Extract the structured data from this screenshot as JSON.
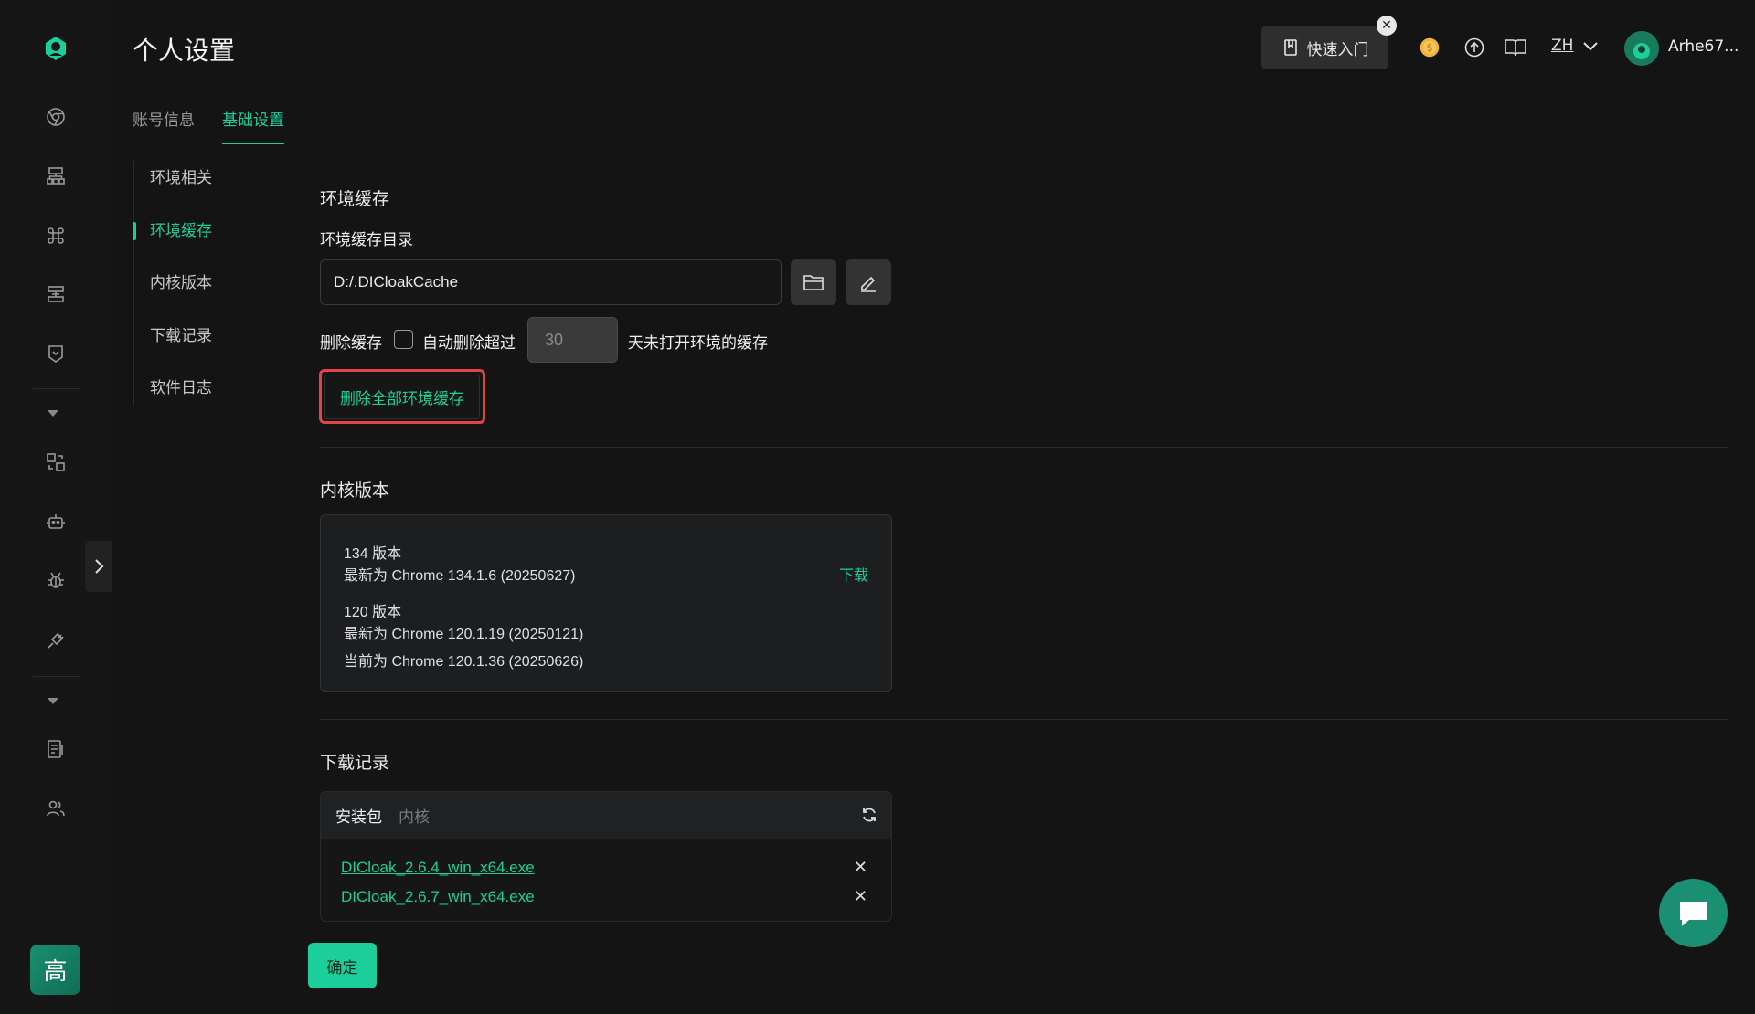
{
  "page": {
    "title": "个人设置",
    "tabs": [
      {
        "label": "账号信息",
        "active": false
      },
      {
        "label": "基础设置",
        "active": true
      }
    ]
  },
  "header": {
    "quick_start_label": "快速入门",
    "lang": "ZH",
    "username": "Arhe67..."
  },
  "side_menu": [
    {
      "label": "环境相关",
      "active": false
    },
    {
      "label": "环境缓存",
      "active": true
    },
    {
      "label": "内核版本",
      "active": false
    },
    {
      "label": "下载记录",
      "active": false
    },
    {
      "label": "软件日志",
      "active": false
    }
  ],
  "cache": {
    "section_title": "环境缓存",
    "dir_label": "环境缓存目录",
    "dir_value": "D:/.DICloakCache",
    "delete_label": "删除缓存",
    "auto_delete_label": "自动删除超过",
    "days_value": "30",
    "days_suffix": "天未打开环境的缓存",
    "delete_all_label": "删除全部环境缓存"
  },
  "kernel": {
    "section_title": "内核版本",
    "v134_title": "134 版本",
    "v134_latest": "最新为 Chrome 134.1.6 (20250627)",
    "download_label": "下载",
    "v120_title": "120 版本",
    "v120_latest": "最新为 Chrome 120.1.19 (20250121)",
    "v120_current": "当前为 Chrome 120.1.36 (20250626)"
  },
  "downloads": {
    "section_title": "下载记录",
    "tab_package": "安装包",
    "tab_kernel": "内核",
    "files": [
      "DICloak_2.6.4_win_x64.exe",
      "DICloak_2.6.7_win_x64.exe"
    ]
  },
  "confirm_label": "确定",
  "plan_badge": "高",
  "colors": {
    "accent": "#1ccf9a",
    "highlight_border": "#e04545",
    "background": "#141414"
  }
}
